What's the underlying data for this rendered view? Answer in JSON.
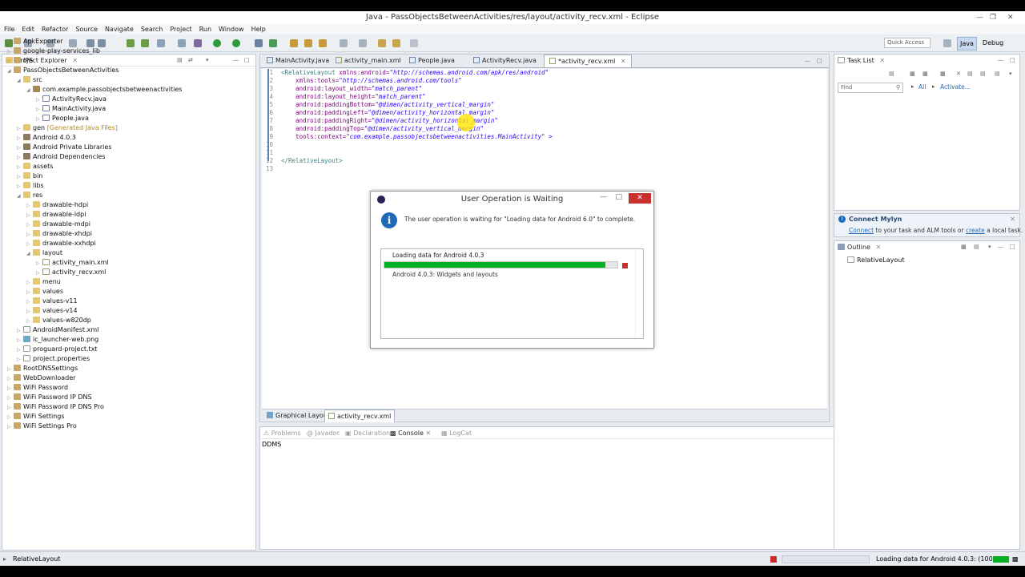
{
  "window": {
    "title": "Java - PassObjectsBetweenActivities/res/layout/activity_recv.xml - Eclipse"
  },
  "menu": [
    "File",
    "Edit",
    "Refactor",
    "Source",
    "Navigate",
    "Search",
    "Project",
    "Run",
    "Window",
    "Help"
  ],
  "toolbar": {
    "quick_access": "Quick Access",
    "perspectives": [
      "Java",
      "Debug"
    ]
  },
  "project_explorer": {
    "title": "Project Explorer",
    "items": [
      {
        "label": "ApkExporter",
        "icon": "project-icon"
      },
      {
        "label": "google-play-services_lib",
        "icon": "project-icon"
      },
      {
        "label": "IPS",
        "icon": "project-icon"
      },
      {
        "label": "PassObjectsBetweenActivities",
        "icon": "project-icon"
      },
      {
        "label": "src",
        "icon": "folder-icon"
      },
      {
        "label": "com.example.passobjectsbetweenactivities",
        "icon": "package-icon"
      },
      {
        "label": "ActivityRecv.java",
        "icon": "java-file-icon"
      },
      {
        "label": "MainActivity.java",
        "icon": "java-file-icon"
      },
      {
        "label": "People.java",
        "icon": "java-file-icon"
      },
      {
        "label": "gen",
        "extra": "[Generated Java Files]",
        "icon": "folder-icon"
      },
      {
        "label": "Android 4.0.3",
        "icon": "library-icon"
      },
      {
        "label": "Android Private Libraries",
        "icon": "library-icon"
      },
      {
        "label": "Android Dependencies",
        "icon": "library-icon"
      },
      {
        "label": "assets",
        "icon": "folder-icon"
      },
      {
        "label": "bin",
        "icon": "folder-icon"
      },
      {
        "label": "libs",
        "icon": "folder-icon"
      },
      {
        "label": "res",
        "icon": "folder-icon"
      },
      {
        "label": "drawable-hdpi",
        "icon": "folder-icon"
      },
      {
        "label": "drawable-ldpi",
        "icon": "folder-icon"
      },
      {
        "label": "drawable-mdpi",
        "icon": "folder-icon"
      },
      {
        "label": "drawable-xhdpi",
        "icon": "folder-icon"
      },
      {
        "label": "drawable-xxhdpi",
        "icon": "folder-icon"
      },
      {
        "label": "layout",
        "icon": "folder-icon"
      },
      {
        "label": "activity_main.xml",
        "icon": "xml-file-icon"
      },
      {
        "label": "activity_recv.xml",
        "icon": "xml-file-icon"
      },
      {
        "label": "menu",
        "icon": "folder-icon"
      },
      {
        "label": "values",
        "icon": "folder-icon"
      },
      {
        "label": "values-v11",
        "icon": "folder-icon"
      },
      {
        "label": "values-v14",
        "icon": "folder-icon"
      },
      {
        "label": "values-w820dp",
        "icon": "folder-icon"
      },
      {
        "label": "AndroidManifest.xml",
        "icon": "xml-file-icon"
      },
      {
        "label": "ic_launcher-web.png",
        "icon": "image-file-icon"
      },
      {
        "label": "proguard-project.txt",
        "icon": "text-file-icon"
      },
      {
        "label": "project.properties",
        "icon": "text-file-icon"
      },
      {
        "label": "RootDNSSettings",
        "icon": "project-icon"
      },
      {
        "label": "WebDownloader",
        "icon": "project-icon"
      },
      {
        "label": "WiFi Password",
        "icon": "project-icon"
      },
      {
        "label": "WiFi Password IP DNS",
        "icon": "project-icon"
      },
      {
        "label": "WiFi Password IP DNS Pro",
        "icon": "project-icon"
      },
      {
        "label": "WiFi Settings",
        "icon": "project-icon"
      },
      {
        "label": "WiFi Settings Pro",
        "icon": "project-icon"
      }
    ]
  },
  "editor": {
    "tabs": [
      "MainActivity.java",
      "activity_main.xml",
      "People.java",
      "ActivityRecv.java",
      "*activity_recv.xml"
    ],
    "lines": [
      {
        "n": "1",
        "t": "<RelativeLayout",
        "a": "xmlns:android=",
        "v": "\"http://schemas.android.com/apk/res/android\""
      },
      {
        "n": "2",
        "t": "",
        "a": "    xmlns:tools=",
        "v": "\"http://schemas.android.com/tools\""
      },
      {
        "n": "3",
        "t": "",
        "a": "    android:layout_width=",
        "v": "\"match_parent\""
      },
      {
        "n": "4",
        "t": "",
        "a": "    android:layout_height=",
        "v": "\"match_parent\""
      },
      {
        "n": "5",
        "t": "",
        "a": "    android:paddingBottom=",
        "v": "\"@dimen/activity_vertical_margin\""
      },
      {
        "n": "6",
        "t": "",
        "a": "    android:paddingLeft=",
        "v": "\"@dimen/activity_horizontal_margin\""
      },
      {
        "n": "7",
        "t": "",
        "a": "    android:paddingRight=",
        "v": "\"@dimen/activity_horizontal_margin\""
      },
      {
        "n": "8",
        "t": "",
        "a": "    android:paddingTop=",
        "v": "\"@dimen/activity_vertical_margin\""
      },
      {
        "n": "9",
        "t": "",
        "a": "    tools:context=",
        "v": "\"com.example.passobjectsbetweenactivities.MainActivity\" >"
      },
      {
        "n": "10",
        "t": "",
        "a": "",
        "v": ""
      },
      {
        "n": "11",
        "t": "",
        "a": "",
        "v": ""
      },
      {
        "n": "12",
        "t": "</RelativeLayout>",
        "a": "",
        "v": ""
      },
      {
        "n": "13",
        "t": "",
        "a": "",
        "v": ""
      }
    ],
    "bottom_tabs": [
      "Graphical Layout",
      "activity_recv.xml"
    ]
  },
  "dialog": {
    "title": "User Operation is Waiting",
    "message": "The user operation is waiting for \"Loading data for Android 6.0\" to complete.",
    "job": "Loading data for Android 4.0.3",
    "progress": 0.95,
    "subtask": "Android 4.0.3: Widgets and layouts"
  },
  "console": {
    "tabs": [
      "Problems",
      "Javadoc",
      "Declaration",
      "Console",
      "LogCat"
    ],
    "content": "DDMS"
  },
  "task_list": {
    "title": "Task List",
    "find_placeholder": "Find",
    "all": "All",
    "activate": "Activate..."
  },
  "mylyn": {
    "title": "Connect Mylyn",
    "link1": "Connect",
    "text1": " to your task and ALM tools or ",
    "link2": "create",
    "text2": " a local task."
  },
  "outline": {
    "title": "Outline",
    "item": "RelativeLayout"
  },
  "status": {
    "left": "RelativeLayout",
    "right": "Loading data for Android 4.0.3: (100%)"
  },
  "colors": {
    "progress": "#06b025",
    "accent": "#1f6ab8",
    "close": "#c9302c"
  }
}
